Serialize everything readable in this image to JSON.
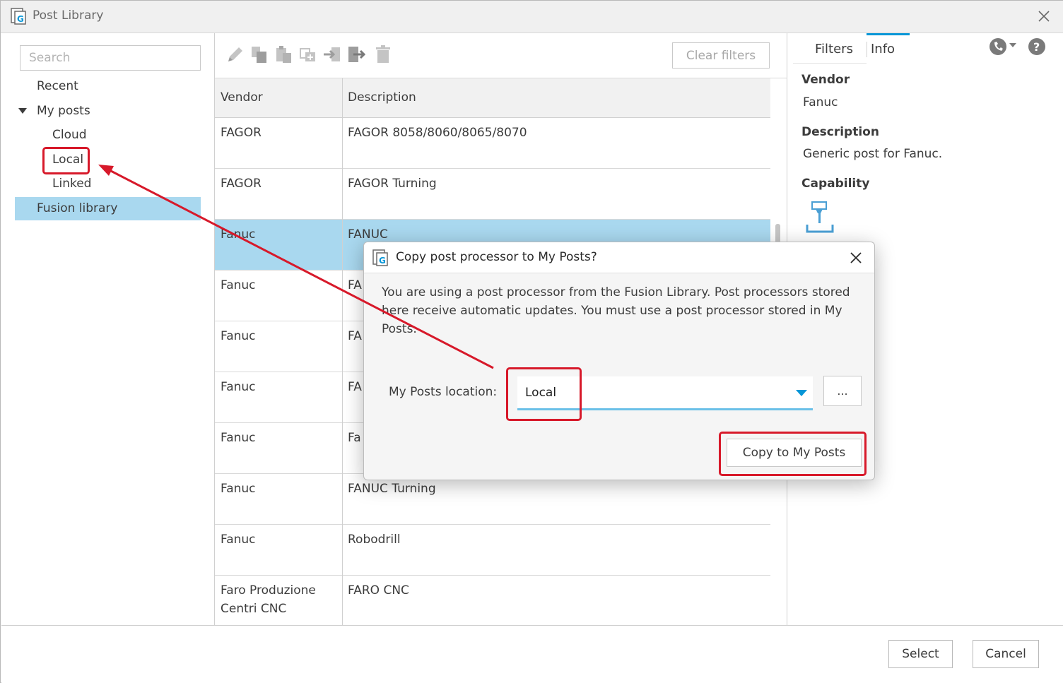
{
  "window": {
    "title": "Post Library"
  },
  "sidebar": {
    "search_placeholder": "Search",
    "recent": "Recent",
    "my_posts": "My posts",
    "cloud": "Cloud",
    "local": "Local",
    "linked": "Linked",
    "fusion_library": "Fusion library"
  },
  "toolbar": {
    "icons": [
      "edit-icon",
      "copy-icon",
      "paste-icon",
      "duplicate-icon",
      "import-icon",
      "export-icon",
      "delete-icon"
    ],
    "clear_filters": "Clear filters"
  },
  "table": {
    "headers": {
      "vendor": "Vendor",
      "description": "Description"
    },
    "rows": [
      {
        "vendor": "FAGOR",
        "description": "FAGOR 8058/8060/8065/8070"
      },
      {
        "vendor": "FAGOR",
        "description": "FAGOR Turning"
      },
      {
        "vendor": "Fanuc",
        "description": "FANUC"
      },
      {
        "vendor": "Fanuc",
        "description": "FA"
      },
      {
        "vendor": "Fanuc",
        "description": "FA"
      },
      {
        "vendor": "Fanuc",
        "description": "FA"
      },
      {
        "vendor": "Fanuc",
        "description": "Fa"
      },
      {
        "vendor": "Fanuc",
        "description": "FANUC Turning"
      },
      {
        "vendor": "Fanuc",
        "description": "Robodrill"
      },
      {
        "vendor": "Faro Produzione Centri CNC",
        "description": "FARO CNC"
      }
    ],
    "selected_index": 2
  },
  "info_panel": {
    "tabs": {
      "filters": "Filters",
      "info": "Info"
    },
    "active_tab": "Info",
    "vendor_label": "Vendor",
    "vendor_value": "Fanuc",
    "description_label": "Description",
    "description_value": "Generic post for Fanuc.",
    "capability_label": "Capability",
    "capability_icon": "milling-icon"
  },
  "footer": {
    "select": "Select",
    "cancel": "Cancel"
  },
  "dialog": {
    "title": "Copy post processor to My Posts?",
    "message": "You are using a post processor from the Fusion Library. Post processors stored here receive automatic updates. You must use a post processor stored in My Posts.",
    "location_label": "My Posts location:",
    "location_value": "Local",
    "browse_label": "...",
    "copy_button": "Copy to My Posts"
  },
  "colors": {
    "selection": "#a9d8ef",
    "accent": "#0696d7",
    "annotation": "#d7192a"
  }
}
